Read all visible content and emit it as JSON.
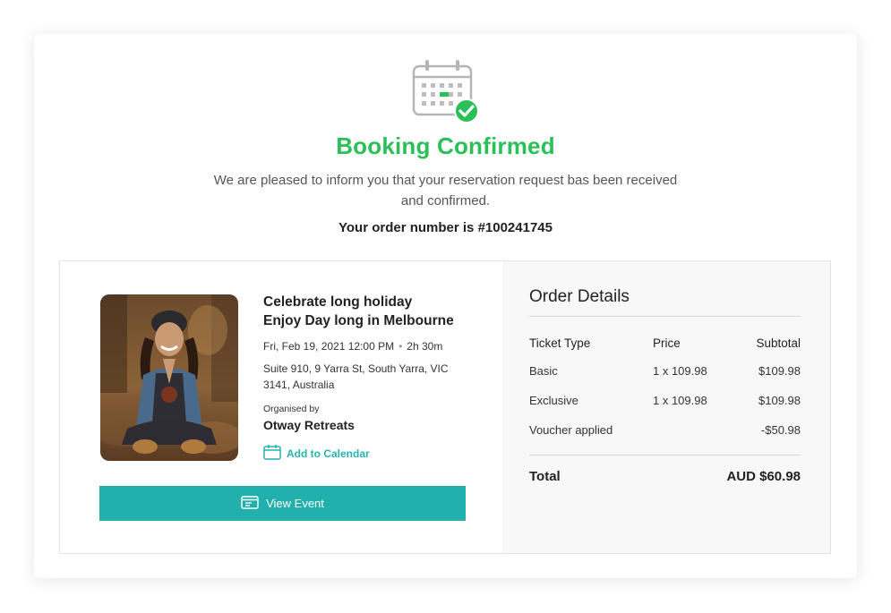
{
  "header": {
    "title": "Booking Confirmed",
    "message": "We are pleased to inform you that your reservation request bas been received and confirmed.",
    "order_number": "Your order number is #100241745",
    "icon": "calendar-check-icon",
    "accent_color": "#2bbf58"
  },
  "event": {
    "title_line1": "Celebrate long holiday",
    "title_line2": "Enjoy Day long in Melbourne",
    "datetime": "Fri, Feb 19, 2021 12:00 PM",
    "duration": "2h 30m",
    "address": "Suite 910, 9 Yarra St, South Yarra, VIC 3141, Australia",
    "organiser_label": "Organised by",
    "organiser_name": "Otway Retreats",
    "add_to_calendar": "Add to Calendar",
    "view_event": "View Event",
    "button_color": "#22b0ac"
  },
  "order": {
    "title": "Order Details",
    "columns": [
      "Ticket Type",
      "Price",
      "Subtotal"
    ],
    "rows": [
      {
        "type": "Basic",
        "price": "1 x 109.98",
        "subtotal": "$109.98"
      },
      {
        "type": "Exclusive",
        "price": "1 x 109.98",
        "subtotal": "$109.98"
      },
      {
        "type": "Voucher applied",
        "price": "",
        "subtotal": "-$50.98"
      }
    ],
    "total_label": "Total",
    "total_value": "AUD $60.98"
  }
}
